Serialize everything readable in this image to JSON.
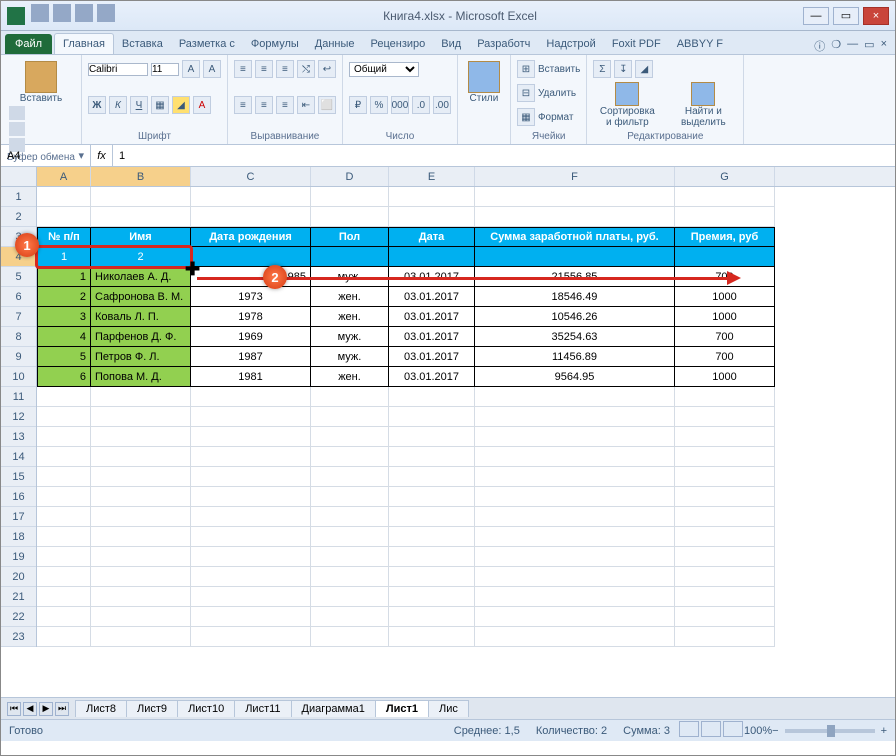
{
  "window": {
    "title": "Книга4.xlsx - Microsoft Excel"
  },
  "ribbon": {
    "file": "Файл",
    "tabs": [
      "Главная",
      "Вставка",
      "Разметка с",
      "Формулы",
      "Данные",
      "Рецензиро",
      "Вид",
      "Разработч",
      "Надстрой",
      "Foxit PDF",
      "ABBYY F"
    ],
    "groups": {
      "clipboard": {
        "paste": "Вставить",
        "label": "Буфер обмена"
      },
      "font": {
        "name": "Calibri",
        "size": "11",
        "label": "Шрифт"
      },
      "align": {
        "label": "Выравнивание"
      },
      "number": {
        "format": "Общий",
        "label": "Число"
      },
      "styles": {
        "btn": "Стили",
        "label": ""
      },
      "cells": {
        "insert": "Вставить",
        "delete": "Удалить",
        "format": "Формат",
        "label": "Ячейки"
      },
      "editing": {
        "sort": "Сортировка и фильтр",
        "find": "Найти и выделить",
        "label": "Редактирование"
      }
    }
  },
  "namebox": "A4",
  "formula": "1",
  "columns": [
    "A",
    "B",
    "C",
    "D",
    "E",
    "F",
    "G"
  ],
  "table": {
    "headers": [
      "№ п/п",
      "Имя",
      "Дата рождения",
      "Пол",
      "Дата",
      "Сумма заработной платы, руб.",
      "Премия, руб"
    ],
    "subrow": [
      "1",
      "2",
      "",
      "",
      "",
      "",
      ""
    ],
    "rows": [
      {
        "n": "1",
        "name": "Николаев А. Д.",
        "birth": "985",
        "sex": "муж.",
        "date": "03.01.2017",
        "salary": "21556.85",
        "bonus": "700"
      },
      {
        "n": "2",
        "name": "Сафронова В. М.",
        "birth": "1973",
        "sex": "жен.",
        "date": "03.01.2017",
        "salary": "18546.49",
        "bonus": "1000"
      },
      {
        "n": "3",
        "name": "Коваль Л. П.",
        "birth": "1978",
        "sex": "жен.",
        "date": "03.01.2017",
        "salary": "10546.26",
        "bonus": "1000"
      },
      {
        "n": "4",
        "name": "Парфенов Д. Ф.",
        "birth": "1969",
        "sex": "муж.",
        "date": "03.01.2017",
        "salary": "35254.63",
        "bonus": "700"
      },
      {
        "n": "5",
        "name": "Петров Ф. Л.",
        "birth": "1987",
        "sex": "муж.",
        "date": "03.01.2017",
        "salary": "11456.89",
        "bonus": "700"
      },
      {
        "n": "6",
        "name": "Попова М. Д.",
        "birth": "1981",
        "sex": "жен.",
        "date": "03.01.2017",
        "salary": "9564.95",
        "bonus": "1000"
      }
    ]
  },
  "callouts": {
    "c1": "1",
    "c2": "2"
  },
  "sheets": [
    "Лист8",
    "Лист9",
    "Лист10",
    "Лист11",
    "Диаграмма1",
    "Лист1",
    "Лис"
  ],
  "status": {
    "ready": "Готово",
    "avg_lbl": "Среднее:",
    "avg": "1,5",
    "cnt_lbl": "Количество:",
    "cnt": "2",
    "sum_lbl": "Сумма:",
    "sum": "3",
    "zoom": "100%"
  }
}
